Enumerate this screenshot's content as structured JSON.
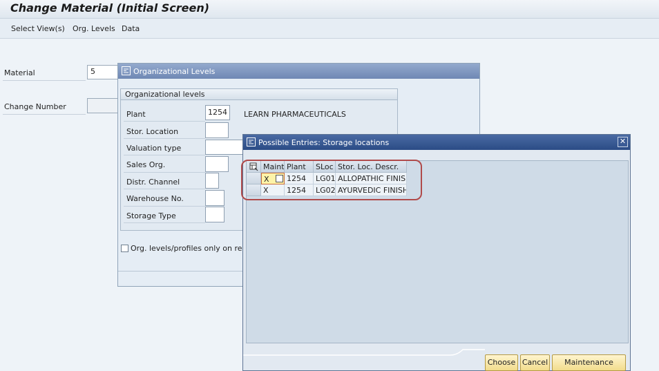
{
  "window": {
    "title": "Change Material (Initial Screen)"
  },
  "menu": [
    "Select View(s)",
    "Org. Levels",
    "Data"
  ],
  "main": {
    "material_label": "Material",
    "material_value": "5",
    "change_number_label": "Change Number",
    "change_number_value": ""
  },
  "org_dialog": {
    "title": "Organizational Levels",
    "group_title": "Organizational levels",
    "fields": [
      {
        "label": "Plant",
        "value": "1254"
      },
      {
        "label": "Stor. Location",
        "value": ""
      },
      {
        "label": "Valuation type",
        "value": ""
      },
      {
        "label": "Sales Org.",
        "value": ""
      },
      {
        "label": "Distr. Channel",
        "value": ""
      },
      {
        "label": "Warehouse No.",
        "value": ""
      },
      {
        "label": "Storage Type",
        "value": ""
      }
    ],
    "plant_description": "LEARN PHARMACEUTICALS",
    "checkbox_label": "Org. levels/profiles only on reques"
  },
  "entries_dialog": {
    "title": "Possible Entries: Storage locations",
    "columns": [
      "Maint.",
      "Plant",
      "SLoc",
      "Stor. Loc. Descr."
    ],
    "rows": [
      {
        "maint": "X",
        "plant": "1254",
        "sloc": "LG01",
        "descr": "ALLOPATHIC FINIS"
      },
      {
        "maint": "X",
        "plant": "1254",
        "sloc": "LG02",
        "descr": "AYURVEDIC FINISH"
      }
    ],
    "buttons": {
      "choose": "Choose",
      "cancel": "Cancel",
      "maintenance": "Maintenance status"
    }
  },
  "colors": {
    "title_bar_active": "#2b4c86",
    "highlight": "#b04a4a",
    "focus_cell": "#fdf3a8"
  }
}
